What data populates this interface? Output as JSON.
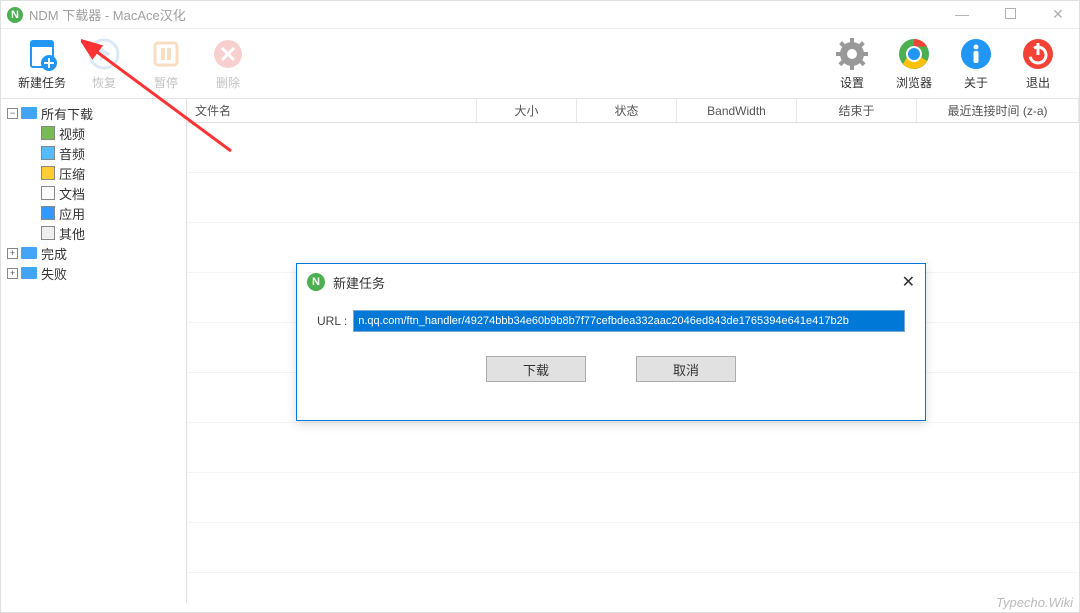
{
  "titlebar": {
    "title": "NDM 下载器 - MacAce汉化"
  },
  "toolbar_left": {
    "new_task": "新建任务",
    "resume": "恢复",
    "pause": "暂停",
    "delete": "删除"
  },
  "toolbar_right": {
    "settings": "设置",
    "browser": "浏览器",
    "about": "关于",
    "exit": "退出"
  },
  "sidebar": {
    "all": "所有下载",
    "video": "视频",
    "audio": "音频",
    "archive": "压缩",
    "document": "文档",
    "app": "应用",
    "other": "其他",
    "done": "完成",
    "failed": "失败"
  },
  "columns": {
    "filename": "文件名",
    "size": "大小",
    "status": "状态",
    "bandwidth": "BandWidth",
    "end": "结束于",
    "recent": "最近连接时间 (z-a)"
  },
  "dialog": {
    "title": "新建任务",
    "url_label": "URL :",
    "url_value": "n.qq.com/ftn_handler/49274bbb34e60b9b8b7f77cefbdea332aac2046ed843de1765394e641e417b2b",
    "download": "下载",
    "cancel": "取消"
  },
  "watermark": "Typecho.Wiki",
  "colors": {
    "accent": "#0078d7",
    "green": "#4CAF50",
    "red": "#f44336",
    "blue": "#2196F3"
  }
}
